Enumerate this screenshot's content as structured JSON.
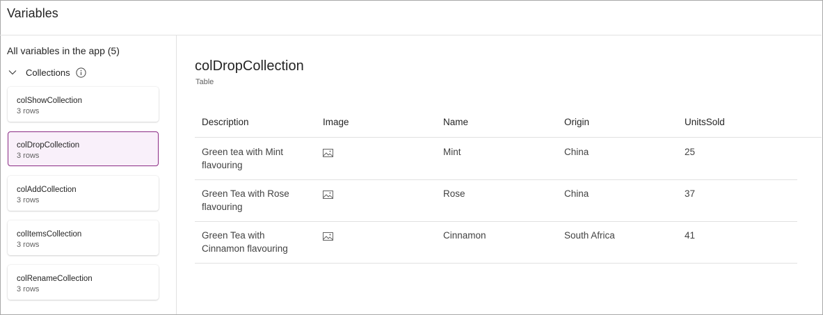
{
  "header": {
    "title": "Variables"
  },
  "sidebar": {
    "heading": "All variables in the app (5)",
    "section_label": "Collections",
    "items": [
      {
        "name": "colShowCollection",
        "rows": "3 rows"
      },
      {
        "name": "colDropCollection",
        "rows": "3 rows"
      },
      {
        "name": "colAddCollection",
        "rows": "3 rows"
      },
      {
        "name": "colItemsCollection",
        "rows": "3 rows"
      },
      {
        "name": "colRenameCollection",
        "rows": "3 rows"
      }
    ]
  },
  "main": {
    "title": "colDropCollection",
    "type": "Table",
    "columns": [
      "Description",
      "Image",
      "Name",
      "Origin",
      "UnitsSold"
    ],
    "rows": [
      {
        "description": "Green tea with Mint flavouring",
        "image": "image-icon",
        "name": "Mint",
        "origin": "China",
        "units": "25"
      },
      {
        "description": "Green Tea with Rose flavouring",
        "image": "image-icon",
        "name": "Rose",
        "origin": "China",
        "units": "37"
      },
      {
        "description": "Green Tea with Cinnamon flavouring",
        "image": "image-icon",
        "name": "Cinnamon",
        "origin": "South Africa",
        "units": "41"
      }
    ]
  },
  "colors": {
    "selected_border": "#8a2a84",
    "selected_bg": "#f9f0fa"
  }
}
